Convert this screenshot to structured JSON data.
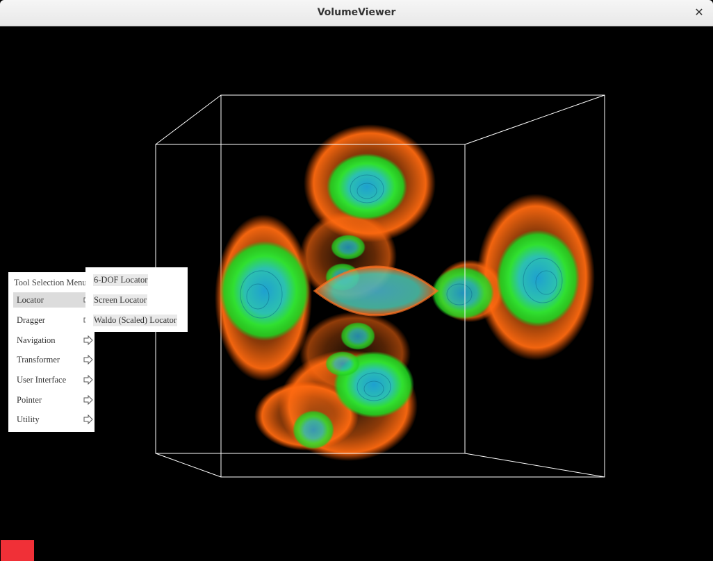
{
  "window": {
    "title": "VolumeViewer"
  },
  "menu": {
    "title": "Tool Selection Menu",
    "items": [
      {
        "label": "Locator"
      },
      {
        "label": "Dragger"
      },
      {
        "label": "Navigation"
      },
      {
        "label": "Transformer"
      },
      {
        "label": "User Interface"
      },
      {
        "label": "Pointer"
      },
      {
        "label": "Utility"
      }
    ],
    "selected": "Locator"
  },
  "submenu": {
    "items": [
      {
        "label": "6-DOF Locator"
      },
      {
        "label": "Screen Locator"
      },
      {
        "label": "Waldo (Scaled) Locator"
      }
    ]
  },
  "colors": {
    "background": "#000000",
    "outer_shell": "#ff6a10",
    "mid_shell": "#28e028",
    "inner_core": "#20a8c8",
    "box_lines": "#ffffff",
    "status_indicator": "#f03037"
  }
}
